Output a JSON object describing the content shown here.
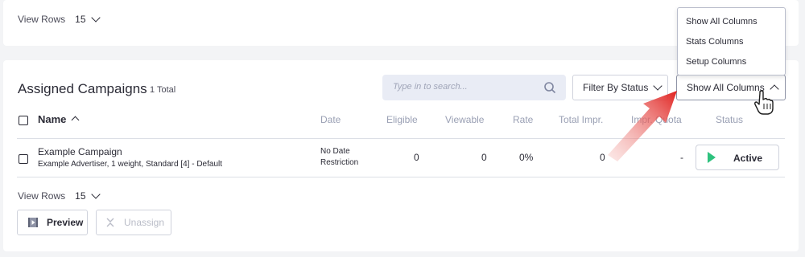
{
  "top": {
    "view_rows_label": "View Rows",
    "view_rows_value": "15"
  },
  "panel": {
    "title": "Assigned Campaigns",
    "total": "1 Total",
    "search_placeholder": "Type in to search...",
    "filter_label": "Filter By Status",
    "columns_label": "Show All Columns"
  },
  "table": {
    "headers": [
      "Name",
      "Date",
      "Eligible",
      "Viewable",
      "Rate",
      "Total Impr.",
      "Impr. Quota",
      "Status"
    ],
    "row": {
      "name": "Example Campaign",
      "subtitle": "Example Advertiser, 1 weight, Standard [4] - Default",
      "date_line1": "No Date",
      "date_line2": "Restriction",
      "eligible": "0",
      "viewable": "0",
      "rate": "0%",
      "total_impr": "0",
      "impr_quota": "-",
      "status": "Active"
    }
  },
  "bottom": {
    "view_rows_label": "View Rows",
    "view_rows_value": "15",
    "preview_label": "Preview",
    "unassign_label": "Unassign"
  },
  "dropdown": {
    "items": [
      "Show All Columns",
      "Stats Columns",
      "Setup Columns"
    ]
  },
  "colors": {
    "accent_green": "#2ec27e",
    "annotation_red": "#e0211f"
  }
}
